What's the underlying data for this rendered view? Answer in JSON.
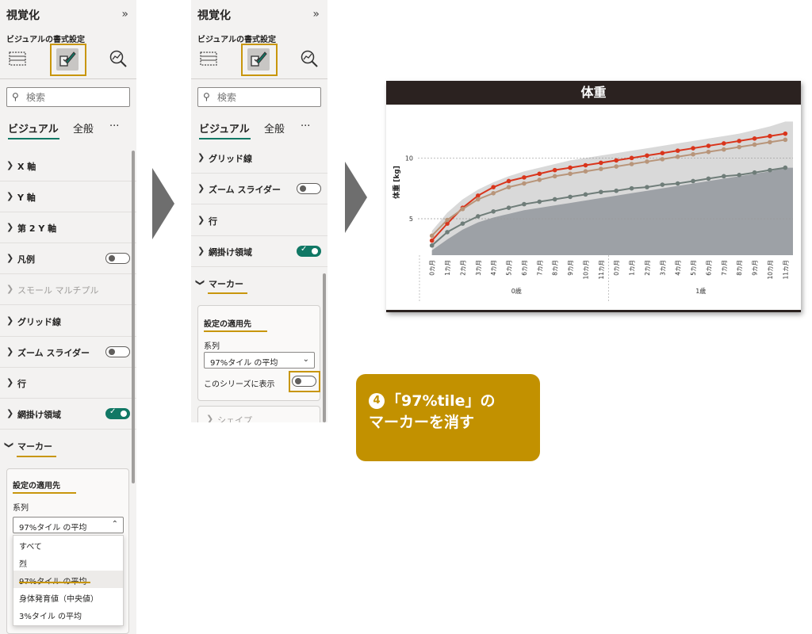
{
  "left_pane": {
    "title": "視覚化",
    "collapse_icon": "»",
    "subtitle": "ビジュアルの書式設定",
    "search_placeholder": "検索",
    "tabs": [
      "ビジュアル",
      "全般",
      "···"
    ],
    "sections": [
      {
        "label": "X 軸",
        "toggle": null,
        "disabled": false
      },
      {
        "label": "Y 軸",
        "toggle": null,
        "disabled": false
      },
      {
        "label": "第 2 Y 軸",
        "toggle": null,
        "disabled": false
      },
      {
        "label": "凡例",
        "toggle": "off",
        "disabled": false
      },
      {
        "label": "スモール マルチプル",
        "toggle": null,
        "disabled": true
      },
      {
        "label": "グリッド線",
        "toggle": null,
        "disabled": false
      },
      {
        "label": "ズーム スライダー",
        "toggle": "off",
        "disabled": false
      },
      {
        "label": "行",
        "toggle": null,
        "disabled": false
      },
      {
        "label": "網掛け領域",
        "toggle": "on",
        "disabled": false
      }
    ],
    "marker_label": "マーカー",
    "apply_title": "設定の適用先",
    "series_label": "系列",
    "series_value": "97%タイル の平均",
    "dropdown_options": [
      "すべて",
      "烈",
      "97%タイル の平均",
      "身体発育値（中央値）",
      "3%タイル の平均"
    ]
  },
  "mid_pane": {
    "title": "視覚化",
    "collapse_icon": "»",
    "subtitle": "ビジュアルの書式設定",
    "search_placeholder": "検索",
    "tabs": [
      "ビジュアル",
      "全般",
      "···"
    ],
    "sections": [
      {
        "label": "グリッド線",
        "toggle": null
      },
      {
        "label": "ズーム スライダー",
        "toggle": "off"
      },
      {
        "label": "行",
        "toggle": null
      },
      {
        "label": "網掛け領域",
        "toggle": "on"
      }
    ],
    "marker_label": "マーカー",
    "apply_title": "設定の適用先",
    "series_label": "系列",
    "series_value": "97%タイル の平均",
    "show_series_label": "このシリーズに表示",
    "shape_label": "シェイプ"
  },
  "callout": {
    "number": "4",
    "line1": "「97%tile」の",
    "line2": "マーカーを消す"
  },
  "colors": {
    "accent_gold": "#c8960c",
    "toggle_on": "#117865",
    "series_97": "#d9351c",
    "series_median": "#b8957a",
    "series_3": "#6f7d79",
    "band_upper": "#d9d9d9",
    "band_lower": "#9da1a6"
  },
  "chart_data": {
    "type": "line",
    "title": "体重",
    "ylabel": "体重 [kg]",
    "xlabel": "",
    "yticks": [
      5,
      10
    ],
    "ylim": [
      2,
      14
    ],
    "categories": [
      "0カ月",
      "1カ月",
      "2カ月",
      "3カ月",
      "4カ月",
      "5カ月",
      "6カ月",
      "7カ月",
      "8カ月",
      "9カ月",
      "10カ月",
      "11カ月",
      "0カ月",
      "1カ月",
      "2カ月",
      "3カ月",
      "4カ月",
      "5カ月",
      "6カ月",
      "7カ月",
      "8カ月",
      "9カ月",
      "10カ月",
      "11カ月"
    ],
    "groups": [
      {
        "label": "0歳",
        "span": 12
      },
      {
        "label": "1歳",
        "span": 12
      }
    ],
    "series": [
      {
        "values": [
          3.2,
          4.6,
          5.9,
          6.9,
          7.6,
          8.1,
          8.4,
          8.7,
          9.0,
          9.2,
          9.4,
          9.6,
          9.8,
          10.0,
          10.2,
          10.4,
          10.6,
          10.8,
          11.0,
          11.2,
          11.4,
          11.6,
          11.8,
          12.0
        ]
      },
      {
        "values": [
          3.6,
          4.9,
          5.8,
          6.6,
          7.1,
          7.6,
          7.9,
          8.2,
          8.5,
          8.7,
          8.9,
          9.1,
          9.3,
          9.5,
          9.7,
          9.9,
          10.1,
          10.3,
          10.5,
          10.7,
          10.9,
          11.1,
          11.3,
          11.5
        ]
      },
      {
        "values": [
          2.8,
          3.9,
          4.6,
          5.2,
          5.6,
          5.9,
          6.2,
          6.4,
          6.6,
          6.8,
          7.0,
          7.2,
          7.3,
          7.5,
          7.6,
          7.8,
          7.9,
          8.1,
          8.3,
          8.5,
          8.6,
          8.8,
          9.0,
          9.2
        ]
      }
    ],
    "bands": [
      {
        "values": [
          4.0,
          5.5,
          6.6,
          7.4,
          8.0,
          8.5,
          8.9,
          9.2,
          9.5,
          9.8,
          10.0,
          10.2,
          10.4,
          10.6,
          10.8,
          11.0,
          11.2,
          11.4,
          11.6,
          11.8,
          12.0,
          12.3,
          12.6,
          13.0
        ]
      },
      {
        "values": [
          2.4,
          3.3,
          4.1,
          4.7,
          5.1,
          5.4,
          5.7,
          5.9,
          6.1,
          6.3,
          6.5,
          6.7,
          6.9,
          7.1,
          7.3,
          7.5,
          7.7,
          7.9,
          8.1,
          8.3,
          8.5,
          8.7,
          8.9,
          9.2
        ]
      }
    ],
    "grid": true
  }
}
